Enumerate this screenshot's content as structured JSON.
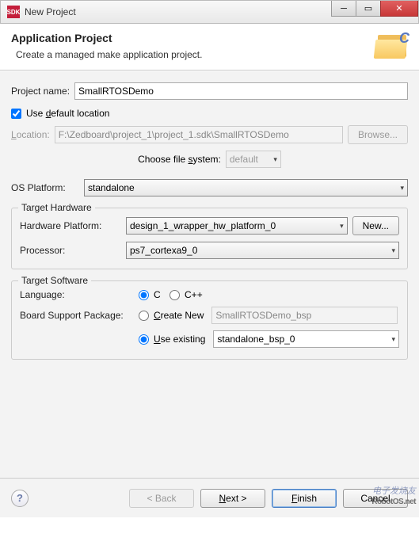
{
  "window": {
    "title": "New Project",
    "icon_label": "SDK"
  },
  "banner": {
    "title": "Application Project",
    "subtitle": "Create a managed make application project."
  },
  "project_name": {
    "label": "Project name:",
    "value": "SmallRTOSDemo"
  },
  "use_default": {
    "checked": true,
    "label_parts": {
      "prefix": "Use ",
      "underlined": "d",
      "suffix": "efault location"
    }
  },
  "location": {
    "label": "Location:",
    "value": "F:\\Zedboard\\project_1\\project_1.sdk\\SmallRTOSDemo",
    "browse": "Browse...",
    "choose_fs_label": "Choose file system:",
    "choose_fs_value": "default"
  },
  "os_platform": {
    "label": "OS Platform:",
    "value": "standalone"
  },
  "target_hardware": {
    "legend": "Target Hardware",
    "hw_platform_label": "Hardware Platform:",
    "hw_platform_value": "design_1_wrapper_hw_platform_0",
    "new_btn": "New...",
    "processor_label": "Processor:",
    "processor_value": "ps7_cortexa9_0"
  },
  "target_software": {
    "legend": "Target Software",
    "language_label": "Language:",
    "lang_c": "C",
    "lang_cpp": "C++",
    "lang_selected": "c",
    "bsp_label": "Board Support Package:",
    "create_new_label": "Create New",
    "create_new_value": "SmallRTOSDemo_bsp",
    "use_existing_label": "Use existing",
    "use_existing_value": "standalone_bsp_0",
    "bsp_selected": "existing"
  },
  "buttons": {
    "back": "< Back",
    "next": "Next >",
    "finish": "Finish",
    "cancel": "Cancel"
  },
  "watermarks": {
    "w1": "电子发烧友",
    "w2": "RobotOS.net"
  }
}
